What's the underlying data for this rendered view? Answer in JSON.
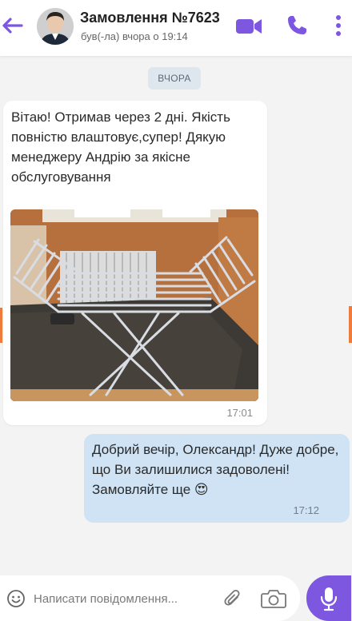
{
  "header": {
    "title": "Замовлення №7623",
    "status": "був(-ла) вчора о 19:14",
    "back_icon": "arrow-left-icon",
    "video_icon": "video-camera-icon",
    "call_icon": "phone-icon",
    "menu_icon": "more-vertical-icon"
  },
  "date_chip": "ВЧОРА",
  "messages": [
    {
      "direction": "incoming",
      "text": "Вітаю! Отримав через 2 дні. Якість повністю влаштовує,супер! Дякую менеджеру Андрію за якісне обслуговування",
      "attachment": "photo",
      "time": "17:01"
    },
    {
      "direction": "outgoing",
      "text": "Добрий вечір, Олександр! Дуже добре, що Ви залишилися задоволені! Замовляйте ще 😍",
      "time": "17:12"
    }
  ],
  "composer": {
    "placeholder": "Написати повідомлення...",
    "emoji_icon": "emoji-icon",
    "attach_icon": "paperclip-icon",
    "camera_icon": "camera-icon",
    "mic_icon": "microphone-icon"
  },
  "colors": {
    "accent": "#7e57e0",
    "outgoing_bubble": "#cfe3f5",
    "background": "#f3f3f3"
  }
}
